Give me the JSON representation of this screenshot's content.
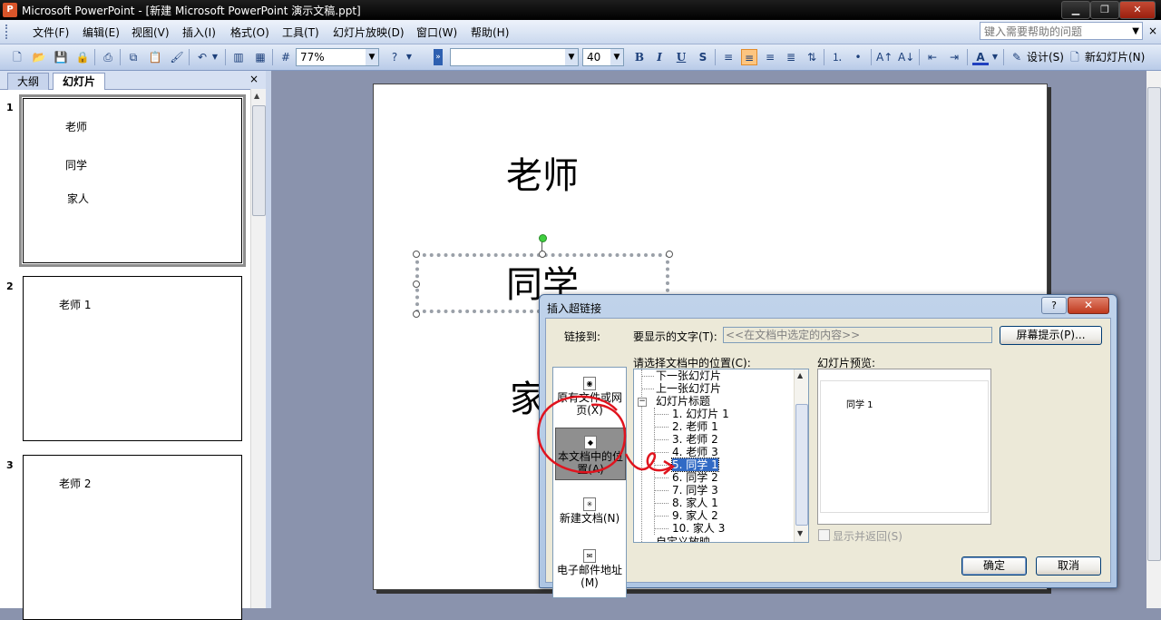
{
  "window": {
    "title": "Microsoft PowerPoint - [新建 Microsoft PowerPoint 演示文稿.ppt]",
    "app_icon": "powerpoint-icon",
    "controls": [
      "minimize-icon",
      "restore-icon",
      "close-icon"
    ]
  },
  "menu": {
    "items": [
      "文件(F)",
      "编辑(E)",
      "视图(V)",
      "插入(I)",
      "格式(O)",
      "工具(T)",
      "幻灯片放映(D)",
      "窗口(W)",
      "帮助(H)"
    ],
    "help_placeholder": "键入需要帮助的问题",
    "doc_close": "×"
  },
  "toolbar": {
    "zoom": "77%",
    "font_name": "",
    "font_size": "40",
    "bold": "B",
    "italic": "I",
    "underline": "U",
    "shadow": "S",
    "design_label": "设计(S)",
    "new_slide_label": "新幻灯片(N)"
  },
  "left_pane": {
    "tabs": [
      "大纲",
      "幻灯片"
    ],
    "close": "×",
    "slides": [
      {
        "num": "1",
        "lines": [
          "老师",
          "同学",
          "家人"
        ]
      },
      {
        "num": "2",
        "lines": [
          "老师 1"
        ]
      },
      {
        "num": "3",
        "lines": [
          "老师 2"
        ]
      }
    ]
  },
  "slide": {
    "lines": [
      "老师",
      "同学",
      "家"
    ]
  },
  "dialog": {
    "title": "插入超链接",
    "help_btn": "?",
    "close_btn": "✕",
    "link_to_label": "链接到:",
    "link_options": [
      {
        "label": "原有文件或网页(X)",
        "icon": "web-page-icon"
      },
      {
        "label": "本文档中的位置(A)",
        "icon": "document-place-icon"
      },
      {
        "label": "新建文档(N)",
        "icon": "new-document-icon"
      },
      {
        "label": "电子邮件地址(M)",
        "icon": "email-icon"
      }
    ],
    "display_text_label": "要显示的文字(T):",
    "display_text_value": "<<在文档中选定的内容>>",
    "screentip_btn": "屏幕提示(P)...",
    "place_label": "请选择文档中的位置(C):",
    "tree": {
      "items": [
        "下一张幻灯片",
        "上一张幻灯片",
        "幻灯片标题"
      ],
      "slide_titles": [
        "1. 幻灯片 1",
        "2. 老师 1",
        "3. 老师 2",
        "4. 老师 3",
        "5. 同学 1",
        "6. 同学 2",
        "7. 同学 3",
        "8. 家人 1",
        "9. 家人 2",
        "10. 家人 3"
      ],
      "last_item": "自定义放映",
      "selected": "5. 同学 1"
    },
    "preview_label": "幻灯片预览:",
    "preview_text": "同学 1",
    "show_and_return": "显示并返回(S)",
    "ok": "确定",
    "cancel": "取消"
  },
  "colors": {
    "annotation": "#e0141e",
    "selection": "#316ac5"
  }
}
